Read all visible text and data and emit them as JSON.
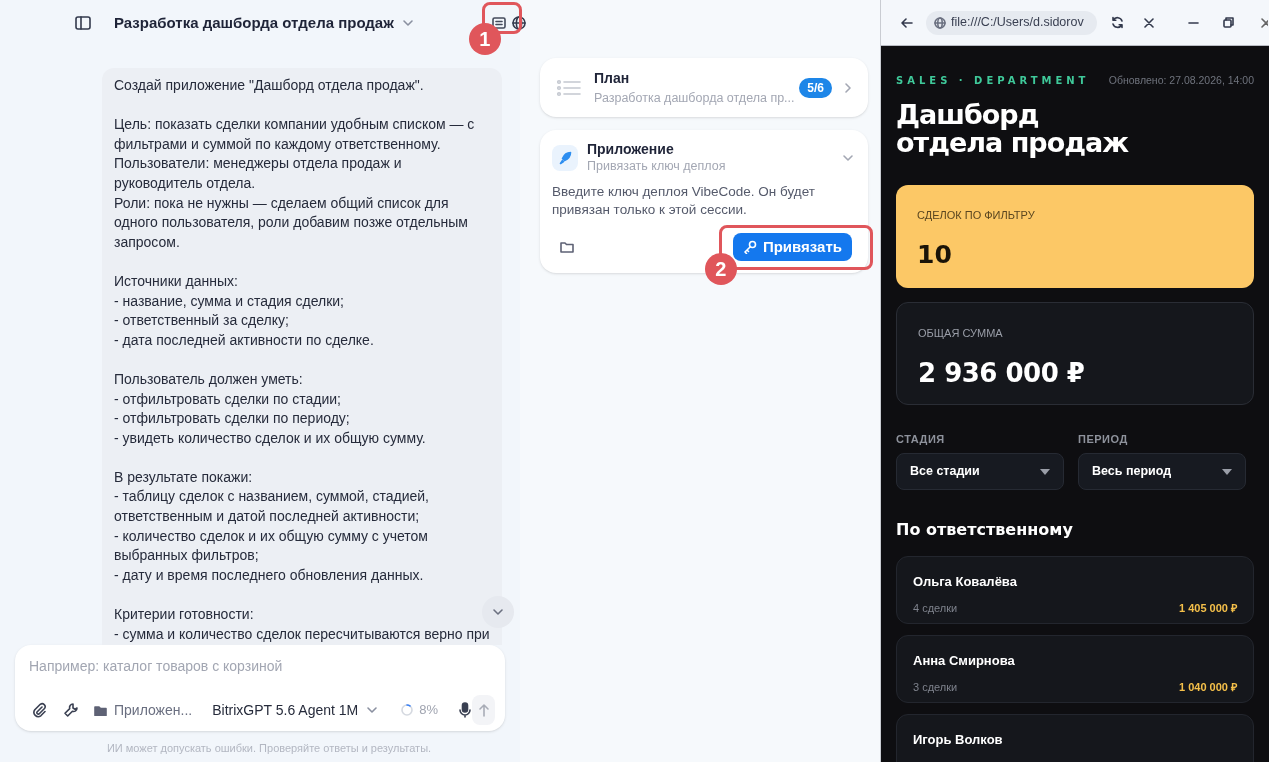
{
  "header": {
    "title": "Разработка дашборда отдела продаж"
  },
  "message": {
    "blocks": [
      [
        "Создай приложение \"Дашборд отдела продаж\"."
      ],
      [
        "Цель: показать сделки компании удобным списком — с",
        "фильтрами и суммой по каждому ответственному.",
        "Пользователи: менеджеры отдела продаж и",
        "руководитель отдела.",
        "Роли: пока не нужны — сделаем общий список для",
        "одного пользователя, роли добавим позже отдельным",
        "запросом."
      ],
      [
        "Источники данных:",
        "- название, сумма и стадия сделки;",
        "- ответственный за сделку;",
        "- дата последней активности по сделке."
      ],
      [
        "Пользователь должен уметь:",
        "- отфильтровать сделки по стадии;",
        "- отфильтровать сделки по периоду;",
        "- увидеть количество сделок и их общую сумму."
      ],
      [
        "В результате покажи:",
        "- таблицу сделок с названием, суммой, стадией,",
        "ответственным и датой последней активности;",
        "- количество сделок и их общую сумму с учетом",
        "выбранных фильтров;",
        "- дату и время последнего обновления данных."
      ],
      [
        "Критерии готовности:",
        "- сумма и количество сделок пересчитываются верно при"
      ]
    ]
  },
  "composer": {
    "placeholder": "Например: каталог товаров с корзиной",
    "folder": "Приложен...",
    "model": "BitrixGPT 5.6 Agent 1M",
    "context": {
      "reading": "8%"
    }
  },
  "disclaimer": "ИИ может допускать ошибки. Проверяйте ответы и результаты.",
  "plan_card": {
    "title": "План",
    "subtitle": "Разработка дашборда отдела пр...",
    "badge": "5/6"
  },
  "app_card": {
    "title": "Приложение",
    "subtitle": "Привязать ключ деплоя",
    "expanded": true,
    "text": "Введите ключ деплоя VibeCode. Он будет привязан только к этой сессии.",
    "button": "Привязать"
  },
  "callouts": [
    {
      "label": "1"
    },
    {
      "label": "2"
    }
  ],
  "browser": {
    "url": "file:///C:/Users/d.sidorov"
  },
  "dashboard": {
    "eyebrow": "SALES · DEPARTMENT",
    "updated": "Обновлено: 27.08.2026, 14:00",
    "title": [
      "Дашборд",
      "отдела продаж"
    ],
    "stats": [
      {
        "kind": "highlight",
        "label": "СДЕЛОК ПО ФИЛЬТРУ",
        "value": "10"
      },
      {
        "kind": "plain",
        "label": "ОБЩАЯ СУММА",
        "value": "2 936 000 ₽"
      }
    ],
    "filters": [
      {
        "label": "СТАДИЯ",
        "value": "Все стадии"
      },
      {
        "label": "ПЕРИОД",
        "value": "Весь период"
      }
    ],
    "section_title": "По ответственному",
    "people": [
      {
        "name": "Ольга Ковалёва",
        "deals": "4 сделки",
        "amount": "1 405 000 ₽"
      },
      {
        "name": "Анна Смирнова",
        "deals": "3 сделки",
        "amount": "1 040 000 ₽"
      },
      {
        "name": "Игорь Волков"
      }
    ]
  }
}
